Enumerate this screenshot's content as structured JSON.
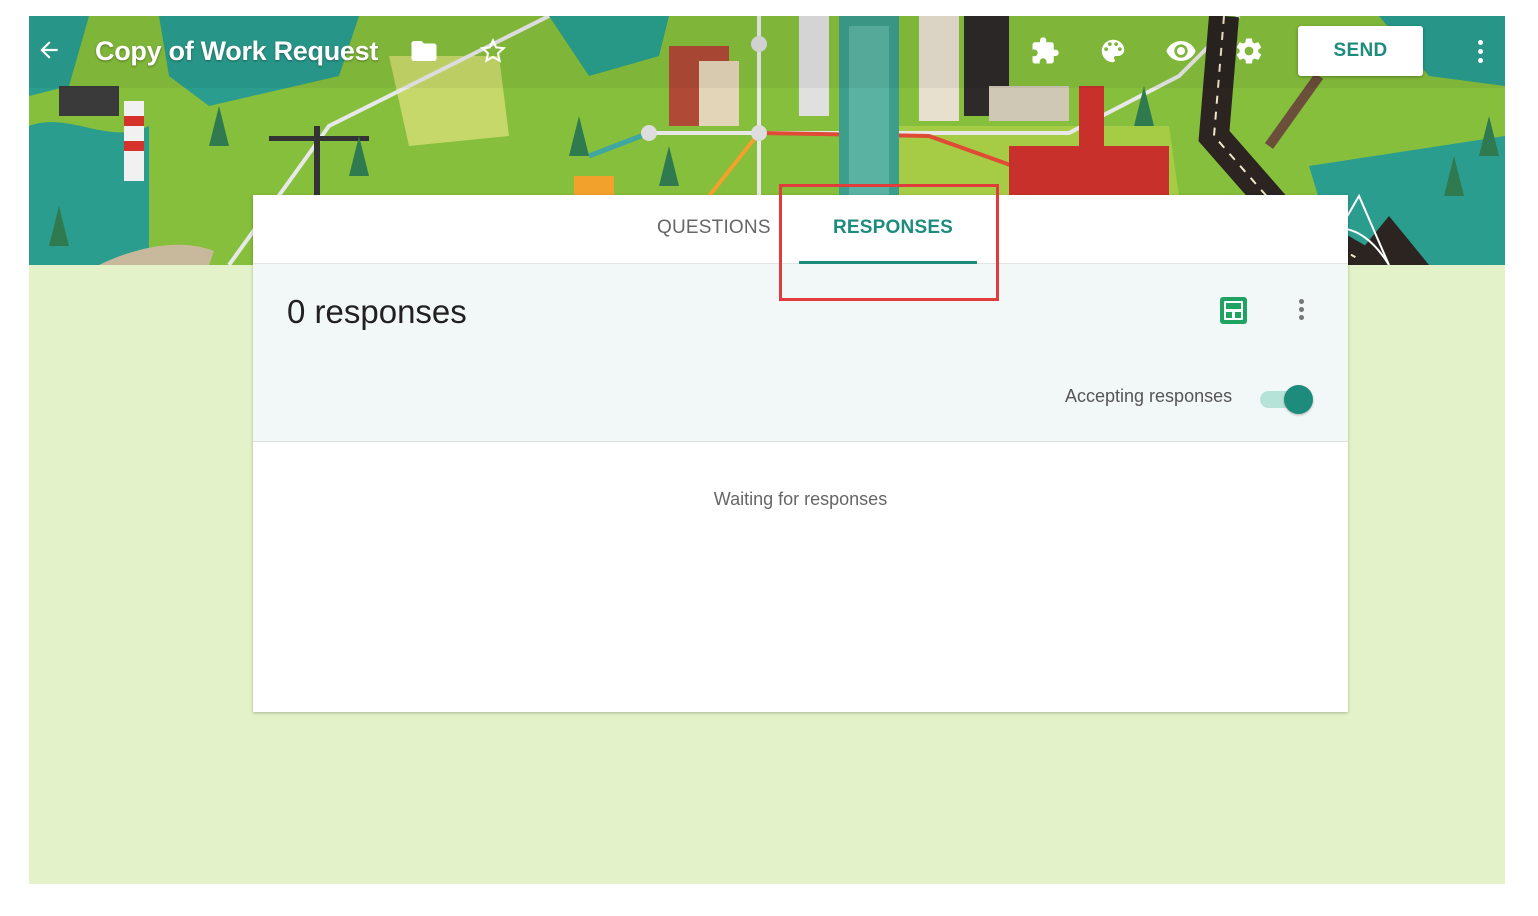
{
  "header": {
    "title": "Copy of Work Request",
    "back_icon": "arrow-back-icon",
    "icons": [
      "folder-icon",
      "star-outline-icon",
      "puzzle-addon-icon",
      "palette-icon",
      "eye-preview-icon",
      "gear-settings-icon",
      "more-vert-icon"
    ],
    "send_label": "SEND",
    "theme": "illustrated city map"
  },
  "tabs": [
    {
      "label": "QUESTIONS",
      "active": false
    },
    {
      "label": "RESPONSES",
      "active": true
    }
  ],
  "responses": {
    "count_text": "0 responses",
    "accepting_label": "Accepting responses",
    "accepting": true,
    "empty_text": "Waiting for responses",
    "sheets_icon": "sheets-create-icon",
    "more_icon": "more-vert-icon"
  },
  "colors": {
    "accent": "#1e8c7c",
    "page_background": "#e3f2c8",
    "summary_background": "#f2f8f7",
    "sheets_green": "#1ea362",
    "highlight": "#e03c3c"
  }
}
